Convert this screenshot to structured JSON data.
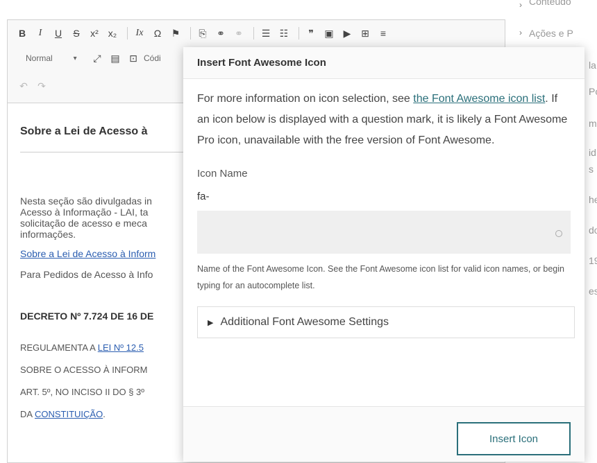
{
  "toolbar": {
    "row1": [
      "B",
      "I",
      "U",
      "S",
      "x²",
      "x₂",
      "Ix",
      "Ω",
      "⚑",
      "⎘",
      "⚭",
      "⚭",
      "☰",
      "☷",
      "❞",
      "▣",
      "▶",
      "⊞",
      "≡"
    ],
    "format_value": "Normal",
    "codigo_label": "Códi"
  },
  "document": {
    "heading": "Sobre a Lei de Acesso à",
    "para1": "Nesta seção são divulgadas in\nAcesso à Informação - LAI, ta\nsolicitação de acesso e meca\ninformações.",
    "link1": "Sobre a Lei de Acesso à Inform",
    "para2": "Para Pedidos de Acesso à Info",
    "decree_heading": "DECRETO Nº 7.724 DE 16 DE",
    "decree_line1_prefix": "REGULAMENTA A ",
    "decree_line1_link": "LEI Nº 12.5",
    "decree_line2": "SOBRE O ACESSO À INFORM",
    "decree_line3": "ART. 5º, NO INCISO II DO § 3º",
    "decree_line4_prefix": "DA ",
    "decree_line4_link": "CONSTITUIÇÃO",
    "decree_line4_suffix": "."
  },
  "sidebar": {
    "item_top": "Conteúdo",
    "item_acoes": "Ações e P",
    "fragments": [
      "la",
      "Po",
      "m",
      "id",
      "s",
      "he",
      "do",
      "19",
      "es"
    ]
  },
  "modal": {
    "title": "Insert Font Awesome Icon",
    "info_before": "For more information on icon selection, see ",
    "info_link": "the Font Awesome icon list",
    "info_after": ". If an icon below is displayed with a question mark, it is likely a Font Awesome Pro icon, unavailable with the free version of Font Awesome.",
    "icon_name_label": "Icon Name",
    "icon_name_value": "fa-",
    "help_text": "Name of the Font Awesome Icon. See the Font Awesome icon list for valid icon names, or begin typing for an autocomplete list.",
    "details_label": "Additional Font Awesome Settings",
    "insert_button": "Insert Icon"
  }
}
